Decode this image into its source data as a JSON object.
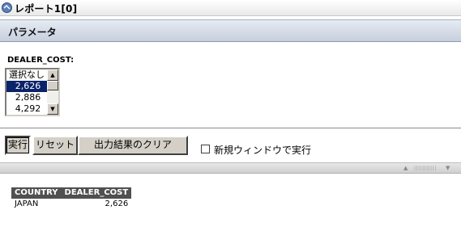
{
  "window": {
    "title": "レポート1[0]",
    "icon": "app-icon"
  },
  "section": {
    "label": "パラメータ"
  },
  "parameter": {
    "label": "DEALER_COST:",
    "options": [
      "選択なし",
      "2,626",
      "2,886",
      "4,292"
    ],
    "selected": "2,626"
  },
  "buttons": {
    "run": "実行",
    "reset": "リセット",
    "clear": "出力結果のクリア"
  },
  "new_window": {
    "label": "新規ウィンドウで実行",
    "checked": false
  },
  "result": {
    "columns": [
      "COUNTRY",
      "DEALER_COST"
    ],
    "rows": [
      [
        "JAPAN",
        "2,626"
      ]
    ]
  }
}
